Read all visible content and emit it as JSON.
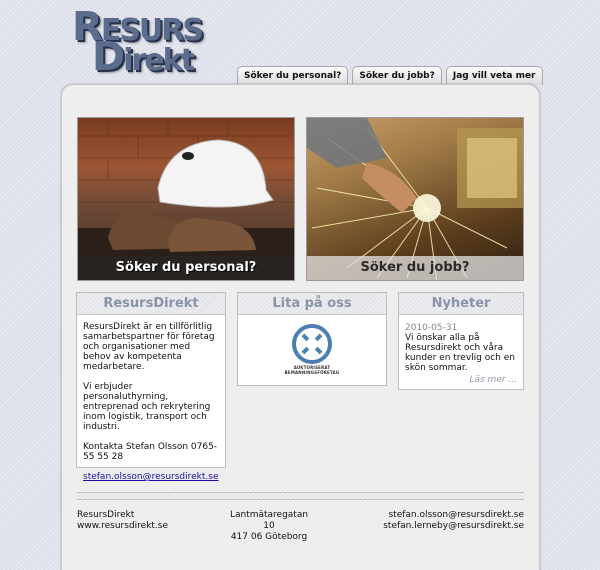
{
  "logo": {
    "line1_initial": "R",
    "line1_rest": "ESURS",
    "line2_initial": "D",
    "line2_rest": "irekt"
  },
  "tabs": [
    {
      "label": "Söker du personal?"
    },
    {
      "label": "Söker du jobb?"
    },
    {
      "label": "Jag vill veta mer"
    }
  ],
  "hero": {
    "left_caption": "Söker du personal?",
    "right_caption": "Söker du jobb?"
  },
  "box_resursdirekt": {
    "title": "ResursDirekt",
    "p1": "ResursDirekt är en tillförlitlig samarbetspartner för företag och organisationer med behov av kompetenta medarbetare.",
    "p2": "Vi erbjuder personaluthyrning, entreprenad och rekrytering inom logistik, transport och industri.",
    "p3": "Kontakta Stefan Olsson 0765-55 55 28",
    "email": "stefan.olsson@resursdirekt.se"
  },
  "box_lita": {
    "title": "Lita på oss",
    "seal_line1": "AUKTORISERAT",
    "seal_line2": "BEMANNINGSFÖRETAG"
  },
  "box_nyheter": {
    "title": "Nyheter",
    "date": "2010-05-31",
    "text": "Vi önskar alla på Resursdirekt och våra kunder en trevlig och en skön sommar.",
    "more": "Läs mer ..."
  },
  "footer": {
    "company": "ResursDirekt",
    "website": "www.resursdirekt.se",
    "street": "Lantmätaregatan 10",
    "city": "417 06 Göteborg",
    "email1": "stefan.olsson@resursdirekt.se",
    "email2": "stefan.lerneby@resursdirekt.se"
  }
}
